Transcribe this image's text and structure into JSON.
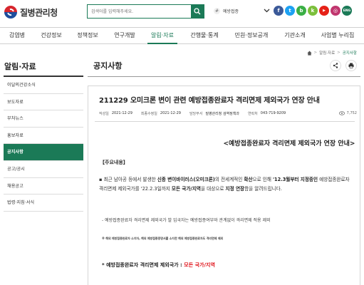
{
  "header": {
    "logo_text": "질병관리청",
    "search_placeholder": "검색어를 입력해주세요.",
    "keyword": "예방접종",
    "sns": [
      {
        "name": "facebook",
        "label": "f",
        "color": "#3b5998"
      },
      {
        "name": "twitter",
        "label": "t",
        "color": "#1da1f2"
      },
      {
        "name": "blog",
        "label": "b",
        "color": "#3aaf45"
      },
      {
        "name": "kakao-story",
        "label": "k",
        "color": "#7bbf3b"
      },
      {
        "name": "youtube",
        "label": "▶",
        "color": "#e62117"
      },
      {
        "name": "instagram",
        "label": "◎",
        "color": "#c0366e"
      },
      {
        "name": "english",
        "label": "ENG",
        "color": "#1b7a57"
      }
    ]
  },
  "nav": [
    {
      "label": "감염병"
    },
    {
      "label": "건강정보"
    },
    {
      "label": "정책정보"
    },
    {
      "label": "연구개발"
    },
    {
      "label": "알림·자료"
    },
    {
      "label": "간행물·통계"
    },
    {
      "label": "민원·정보공개"
    },
    {
      "label": "기관소개"
    },
    {
      "label": "사업별 누리집"
    }
  ],
  "sidebar": {
    "title": "알림·자료",
    "items": [
      {
        "label": "이달의건강소식"
      },
      {
        "label": "보도자료"
      },
      {
        "label": "부처뉴스"
      },
      {
        "label": "홍보자료"
      },
      {
        "label": "공지사항"
      },
      {
        "label": "공고/공시"
      },
      {
        "label": "채용공고"
      },
      {
        "label": "법령·지침·서식"
      }
    ]
  },
  "breadcrumb": {
    "level1": "알림·자료",
    "current": "공지사항"
  },
  "page_title": "공지사항",
  "post": {
    "title": "211229 오미크론 변이 관련 예방접종완료자 격리면제 제외국가 연장 안내",
    "meta": {
      "written_label": "작성일",
      "written": "2021-12-29",
      "modified_label": "최종수정일",
      "modified": "2021-12-29",
      "dept_label": "담당부서",
      "dept": "질병관리청 검역정책과",
      "contact_label": "연락처",
      "contact": "043-719-9209",
      "views": "7,752"
    },
    "heading": "<예방접종완료자 격리면제 제외국가 연장 안내>",
    "section_label": "【주요내용】",
    "para_prefix": "▪ 최근 남아공 등에서 발생한 ",
    "para_b1": "신종 변이바이러스(오미크론)",
    "para_mid1": "의 전세계적인 ",
    "para_b2": "확산",
    "para_mid2": "으로 인해 ",
    "para_b3": "'12.3월부터 지정중인",
    "para_mid3": " 예방접종완료자 격리면제 제외국가를 '22.2.3일까지 ",
    "para_b4": "모든 국가/지역",
    "para_mid4": "을 대상으로 ",
    "para_b5": "지정 연장",
    "para_end": "함을 알려드립니다.",
    "para2": "- 예방접종완료자 격리면제 제외국가 발 입국자는 예방접종여부와 관계없이 격리면제 적용 제외",
    "note": "※ 해외 예방접종완료자 소지자, 해외 예방접종증명서를 소지한 해외 예방접종완료자도 격리면제 제외",
    "exempt_label": "* 예방접종완료자 격리면제 제외국가 : ",
    "exempt_value": "모든 국가/지역"
  },
  "colors": {
    "accent": "#1b7a57",
    "red": "#e0141b"
  }
}
